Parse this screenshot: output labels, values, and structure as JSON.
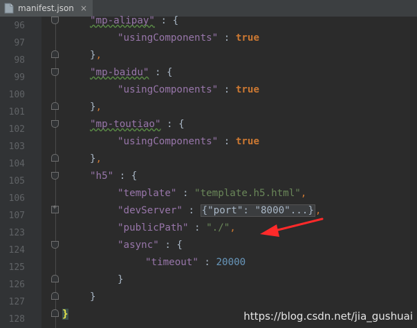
{
  "tab": {
    "filename": "manifest.json",
    "close_glyph": "×"
  },
  "lines": [
    {
      "n": "96"
    },
    {
      "n": "97"
    },
    {
      "n": "98"
    },
    {
      "n": "99"
    },
    {
      "n": "100"
    },
    {
      "n": "101"
    },
    {
      "n": "102"
    },
    {
      "n": "103"
    },
    {
      "n": "104"
    },
    {
      "n": "105"
    },
    {
      "n": "106"
    },
    {
      "n": "107"
    },
    {
      "n": "123"
    },
    {
      "n": "124"
    },
    {
      "n": "125"
    },
    {
      "n": "126"
    },
    {
      "n": "127"
    },
    {
      "n": "128"
    }
  ],
  "code": {
    "mp_alipay": "\"mp-alipay\"",
    "mp_baidu": "\"mp-baidu\"",
    "mp_toutiao": "\"mp-toutiao\"",
    "using_components": "\"usingComponents\"",
    "true_val": "true",
    "h5": "\"h5\"",
    "template_key": "\"template\"",
    "template_val": "\"template.h5.html\"",
    "devserver_key": "\"devServer\"",
    "devserver_folded": "{\"port\": \"8000\"...}",
    "publicpath_key": "\"publicPath\"",
    "publicpath_val": "\"./\"",
    "async_key": "\"async\"",
    "timeout_key": "\"timeout\"",
    "timeout_val": "20000",
    "colon": " : ",
    "open_brace": "{",
    "close_brace": "}",
    "close_brace_comma": "},",
    "comma": ","
  },
  "watermark": "https://blog.csdn.net/jia_gushuai",
  "colors": {
    "background": "#2b2b2b",
    "key": "#9876aa",
    "string": "#6a8759",
    "keyword": "#cc7832",
    "number": "#6897bb",
    "annotation_arrow": "#ff2a2a"
  }
}
